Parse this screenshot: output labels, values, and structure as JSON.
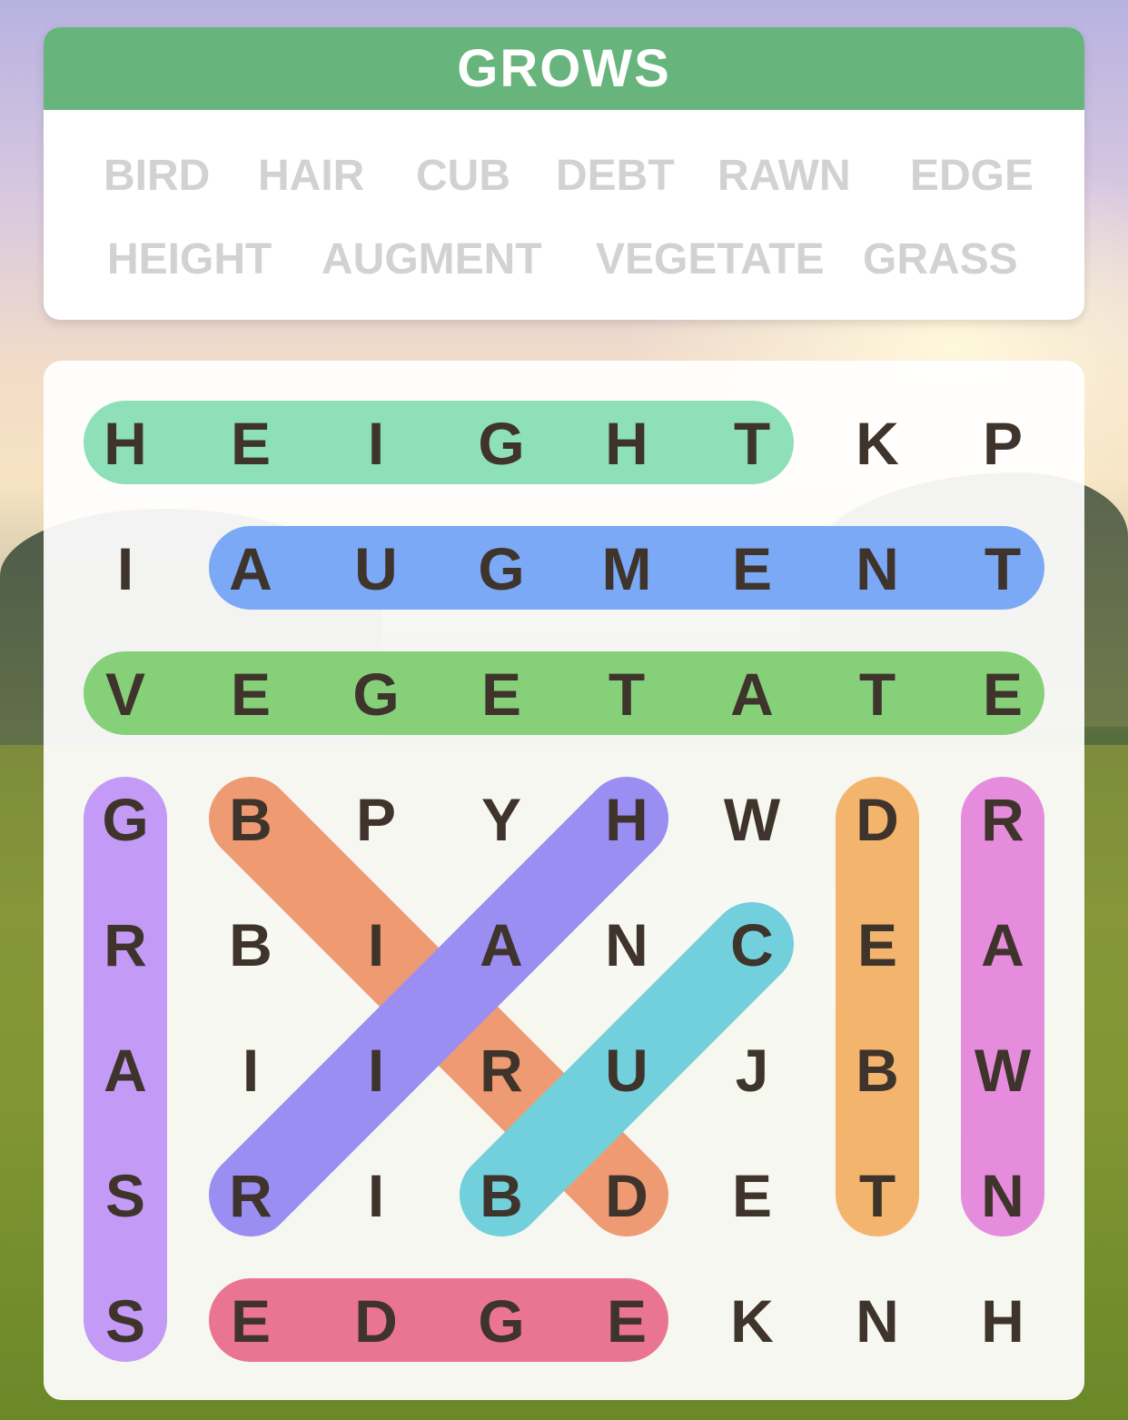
{
  "category": "GROWS",
  "words": [
    [
      "BIRD",
      "HAIR",
      "CUB",
      "DEBT",
      "RAWN",
      "EDGE"
    ],
    [
      "HEIGHT",
      "AUGMENT",
      "VEGETATE",
      "GRASS"
    ]
  ],
  "grid": [
    [
      "H",
      "E",
      "I",
      "G",
      "H",
      "T",
      "K",
      "P"
    ],
    [
      "I",
      "A",
      "U",
      "G",
      "M",
      "E",
      "N",
      "T"
    ],
    [
      "V",
      "E",
      "G",
      "E",
      "T",
      "A",
      "T",
      "E"
    ],
    [
      "G",
      "B",
      "P",
      "Y",
      "H",
      "W",
      "D",
      "R"
    ],
    [
      "R",
      "B",
      "I",
      "A",
      "N",
      "C",
      "E",
      "A"
    ],
    [
      "A",
      "I",
      "I",
      "R",
      "U",
      "J",
      "B",
      "W"
    ],
    [
      "S",
      "R",
      "I",
      "B",
      "D",
      "E",
      "T",
      "N"
    ],
    [
      "S",
      "E",
      "D",
      "G",
      "E",
      "K",
      "N",
      "H"
    ]
  ],
  "found": [
    {
      "word": "HEIGHT",
      "start": [
        0,
        0
      ],
      "end": [
        0,
        5
      ],
      "color": "#8ee0b8"
    },
    {
      "word": "AUGMENT",
      "start": [
        1,
        1
      ],
      "end": [
        1,
        7
      ],
      "color": "#7ba9f5"
    },
    {
      "word": "VEGETATE",
      "start": [
        2,
        0
      ],
      "end": [
        2,
        7
      ],
      "color": "#86d07a"
    },
    {
      "word": "GRASS",
      "start": [
        3,
        0
      ],
      "end": [
        7,
        0
      ],
      "color": "#c39af5"
    },
    {
      "word": "BIRD",
      "start": [
        3,
        1
      ],
      "end": [
        6,
        4
      ],
      "color": "#ee9a72"
    },
    {
      "word": "HAIR",
      "start": [
        3,
        4
      ],
      "end": [
        6,
        1
      ],
      "color": "#9b8ef3"
    },
    {
      "word": "CUB",
      "start": [
        4,
        5
      ],
      "end": [
        6,
        3
      ],
      "color": "#72d0dc"
    },
    {
      "word": "DEBT",
      "start": [
        3,
        6
      ],
      "end": [
        6,
        6
      ],
      "color": "#f3b56e"
    },
    {
      "word": "RAWN",
      "start": [
        3,
        7
      ],
      "end": [
        6,
        7
      ],
      "color": "#e68cdc"
    },
    {
      "word": "EDGE",
      "start": [
        7,
        1
      ],
      "end": [
        7,
        4
      ],
      "color": "#ea7592"
    }
  ]
}
